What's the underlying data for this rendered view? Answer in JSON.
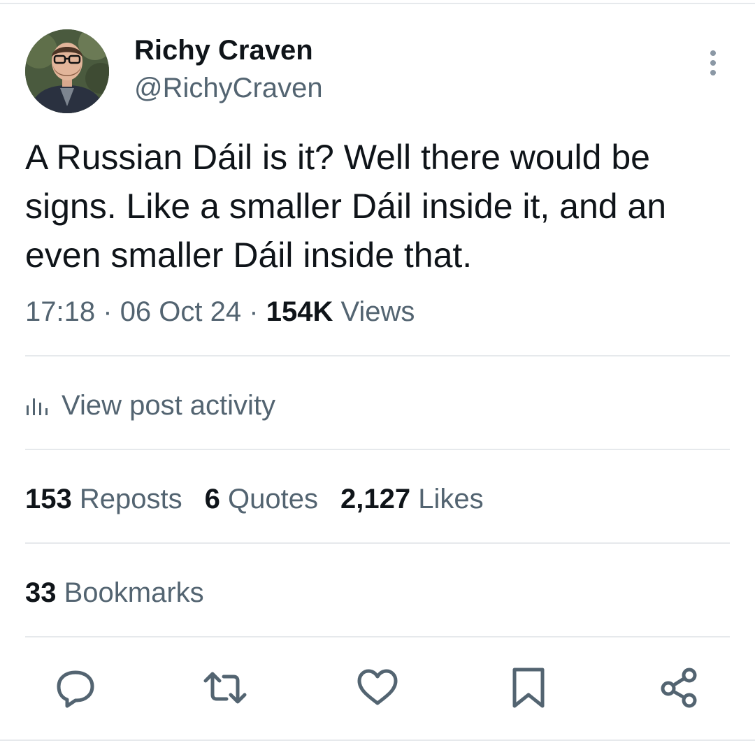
{
  "author": {
    "display_name": "Richy Craven",
    "handle": "@RichyCraven",
    "avatar_icon": "profile-photo"
  },
  "post": {
    "text": "A Russian Dáil is it? Well there would be signs. Like a smaller Dáil inside it, and an even smaller Dáil inside that.",
    "time": "17:18",
    "date": "06 Oct 24",
    "separator": "·",
    "views_count": "154K",
    "views_label": "Views"
  },
  "activity": {
    "icon": "bar-chart-icon",
    "label": "View post activity"
  },
  "stats": {
    "reposts_count": "153",
    "reposts_label": "Reposts",
    "quotes_count": "6",
    "quotes_label": "Quotes",
    "likes_count": "2,127",
    "likes_label": "Likes",
    "bookmarks_count": "33",
    "bookmarks_label": "Bookmarks"
  },
  "actions": [
    "reply-icon",
    "repost-icon",
    "like-icon",
    "bookmark-icon",
    "share-icon"
  ],
  "colors": {
    "text_primary": "#0f1419",
    "text_secondary": "#536471",
    "divider": "#e6e9ec"
  }
}
